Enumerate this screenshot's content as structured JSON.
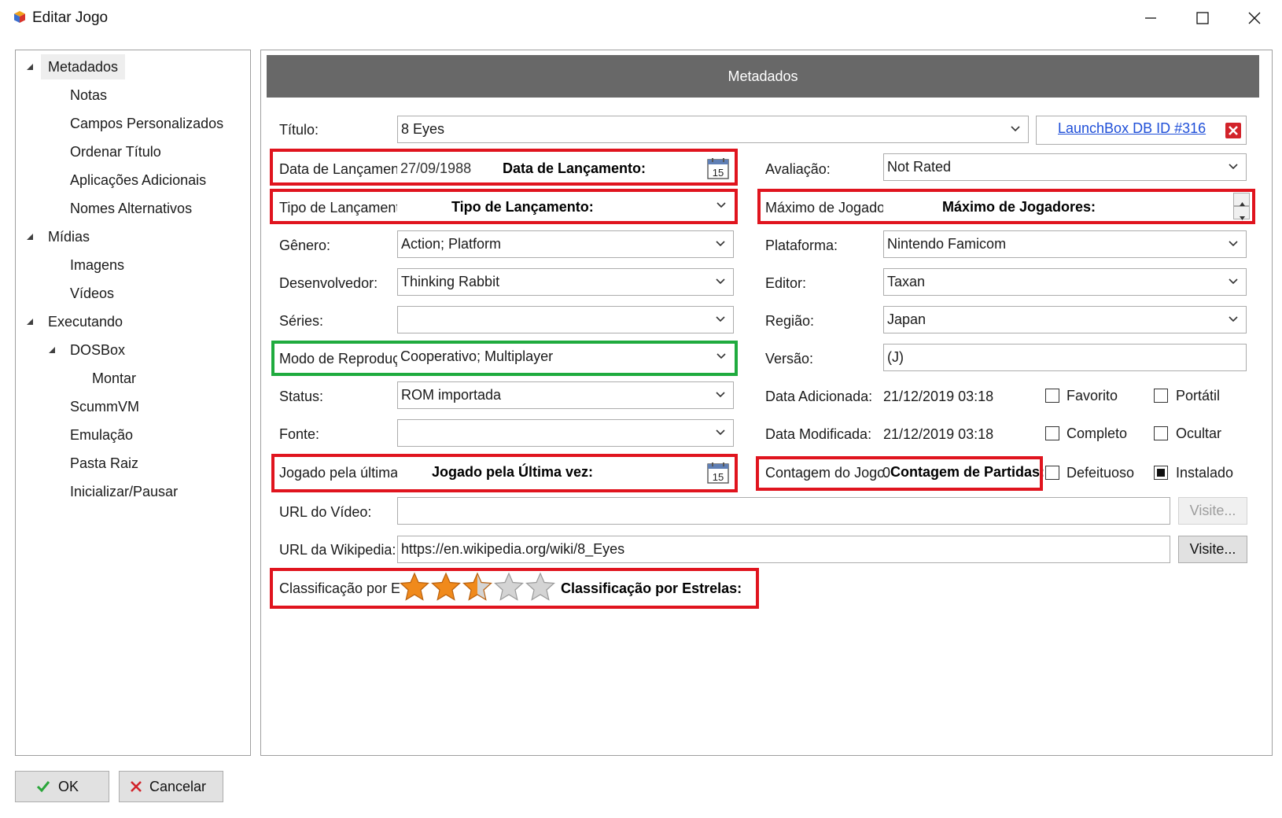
{
  "window": {
    "title": "Editar Jogo"
  },
  "tree": {
    "items": [
      {
        "label": "Metadados",
        "level": 0,
        "expandable": true,
        "selected": true
      },
      {
        "label": "Notas",
        "level": 1
      },
      {
        "label": "Campos Personalizados",
        "level": 1
      },
      {
        "label": "Ordenar Título",
        "level": 1
      },
      {
        "label": "Aplicações Adicionais",
        "level": 1
      },
      {
        "label": "Nomes Alternativos",
        "level": 1
      },
      {
        "label": "Mídias",
        "level": 0,
        "expandable": true
      },
      {
        "label": "Imagens",
        "level": 1
      },
      {
        "label": "Vídeos",
        "level": 1
      },
      {
        "label": "Executando",
        "level": 0,
        "expandable": true
      },
      {
        "label": "DOSBox",
        "level": 1,
        "expandable": true
      },
      {
        "label": "Montar",
        "level": 2
      },
      {
        "label": "ScummVM",
        "level": 1
      },
      {
        "label": "Emulação",
        "level": 1
      },
      {
        "label": "Pasta Raiz",
        "level": 1
      },
      {
        "label": "Inicializar/Pausar",
        "level": 1
      }
    ]
  },
  "header": {
    "title": "Metadados"
  },
  "form": {
    "titulo": {
      "label": "Título:",
      "value": "8 Eyes"
    },
    "launchbox_link": "LaunchBox DB ID #316",
    "data_lancamento": {
      "label": "Data de Lançament",
      "value": "27/09/1988",
      "overlay": "Data de Lançamento:",
      "cal_day": "15"
    },
    "avaliacao": {
      "label": "Avaliação:",
      "value": "Not Rated"
    },
    "tipo_lancamento": {
      "label": "Tipo de Lançament",
      "value": "",
      "overlay": "Tipo de Lançamento:"
    },
    "maximo_jogadores": {
      "label": "Máximo de Jogado",
      "value": "",
      "overlay": "Máximo de Jogadores:"
    },
    "genero": {
      "label": "Gênero:",
      "value": "Action; Platform"
    },
    "plataforma": {
      "label": "Plataforma:",
      "value": "Nintendo Famicom"
    },
    "desenvolvedor": {
      "label": "Desenvolvedor:",
      "value": "Thinking Rabbit"
    },
    "editor": {
      "label": "Editor:",
      "value": "Taxan"
    },
    "series": {
      "label": "Séries:",
      "value": ""
    },
    "regiao": {
      "label": "Região:",
      "value": "Japan"
    },
    "modo": {
      "label": "Modo de Reproduç",
      "value": "Cooperativo; Multiplayer"
    },
    "versao": {
      "label": "Versão:",
      "value": "(J)"
    },
    "status": {
      "label": "Status:",
      "value": "ROM importada"
    },
    "data_adicionada": {
      "label": "Data Adicionada:",
      "value": "21/12/2019 03:18"
    },
    "fonte": {
      "label": "Fonte:",
      "value": ""
    },
    "data_modificada": {
      "label": "Data Modificada:",
      "value": "21/12/2019 03:18"
    },
    "jogado_ultima": {
      "label": "Jogado pela última",
      "value": "",
      "overlay": "Jogado pela Última vez:",
      "cal_day": "15"
    },
    "contagem": {
      "label": "Contagem do Jogo",
      "value": "0",
      "overlay": "Contagem de Partidas:"
    },
    "url_video": {
      "label": "URL do Vídeo:",
      "value": "",
      "button": "Visite..."
    },
    "url_wikipedia": {
      "label": "URL da Wikipedia:",
      "value": "https://en.wikipedia.org/wiki/8_Eyes",
      "button": "Visite..."
    },
    "classificacao": {
      "label": "Classificação por Es",
      "overlay": "Classificação por Estrelas:",
      "rating": 2.5,
      "max": 5
    }
  },
  "checkboxes": [
    {
      "label": "Favorito",
      "checked": false
    },
    {
      "label": "Portátil",
      "checked": false
    },
    {
      "label": "Completo",
      "checked": false
    },
    {
      "label": "Ocultar",
      "checked": false
    },
    {
      "label": "Defeituoso",
      "checked": false
    },
    {
      "label": "Instalado",
      "checked": true
    }
  ],
  "footer": {
    "ok": "OK",
    "cancel": "Cancelar"
  },
  "colors": {
    "header_bg": "#686868",
    "highlight_red": "#e0141e",
    "highlight_green": "#1fab3e",
    "link": "#1f4fd8",
    "star": "#f08a1c"
  }
}
